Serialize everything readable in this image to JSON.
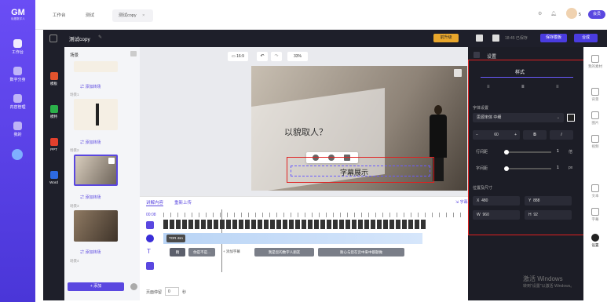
{
  "app": {
    "logo": "GM",
    "logo_sub": "硅基数字人"
  },
  "rail": [
    {
      "label": "工作台"
    },
    {
      "label": "数字分身"
    },
    {
      "label": "内容管理"
    },
    {
      "label": "我的"
    }
  ],
  "browser_tabs": [
    {
      "label": "工作台"
    },
    {
      "label": "测试"
    },
    {
      "label": "测试copy"
    }
  ],
  "topbar": {
    "user_badge": "5",
    "vip": "会员"
  },
  "editor": {
    "title": "测试copy",
    "member_label": "前升级",
    "saved": "18:45 已保存",
    "save_btn": "保存模板",
    "compose_btn": "合成"
  },
  "tools": [
    {
      "label": "模板"
    },
    {
      "label": "模特"
    },
    {
      "label": "PPT"
    },
    {
      "label": "Word"
    }
  ],
  "scenes": {
    "header": "场景",
    "add_scene": "添加转场",
    "items": [
      {
        "label": "场景1"
      },
      {
        "label": "场景2"
      },
      {
        "label": "场景3"
      },
      {
        "label": "场景4"
      },
      {
        "label": "场景5"
      }
    ],
    "add_btn": "+ 添加"
  },
  "canvas": {
    "ratio": "16:9",
    "zoom": "33%",
    "main_text": "以貌取人？",
    "subtitle": "字幕展示"
  },
  "timeline": {
    "tab_script": "讲解内容",
    "tab_upload": "重新上传",
    "time": "00:08",
    "audio_label": "TOR 4sn",
    "clips": [
      "稿",
      "你是不是...",
      "+ 添加字幕",
      "我是您的数字人朋友",
      "耐心与您在云中来中都题做"
    ],
    "page_label": "页面停留",
    "page_val": "0",
    "page_unit": "秒",
    "sub_label": "字幕"
  },
  "settings": {
    "title": "设置",
    "tab_style": "样式",
    "font_label": "字体设置",
    "font_name": "思源宋体 中细",
    "font_size": "60",
    "bold": "B",
    "italic": "I",
    "line_spacing_label": "行间距",
    "line_spacing_val": "1",
    "line_spacing_unit": "倍",
    "char_spacing_label": "字间距",
    "char_spacing_val": "1",
    "char_spacing_unit": "px",
    "pos_label": "位置及尺寸",
    "x_label": "X",
    "x_val": "480",
    "y_label": "Y",
    "y_val": "888",
    "w_label": "W",
    "w_val": "960",
    "h_label": "H",
    "h_val": "92"
  },
  "right_col": [
    {
      "label": "我的素材"
    },
    {
      "label": "背景"
    },
    {
      "label": "图片"
    },
    {
      "label": "视频"
    },
    {
      "label": "文本"
    },
    {
      "label": "字幕"
    },
    {
      "label": "设置"
    }
  ],
  "watermark": {
    "line1": "激活 Windows",
    "line2": "转到\"设置\"以激活 Windows。"
  }
}
